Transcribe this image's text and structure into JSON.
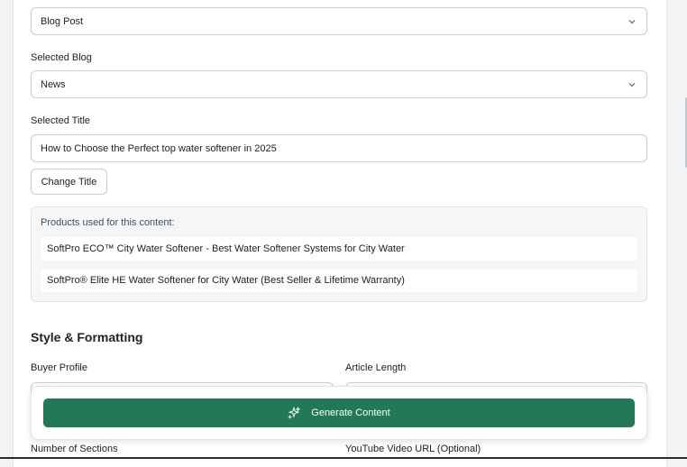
{
  "content_type": {
    "value": "Blog Post"
  },
  "selected_blog": {
    "label": "Selected Blog",
    "value": "News"
  },
  "selected_title": {
    "label": "Selected Title",
    "value": "How to Choose the Perfect top water softener in 2025",
    "change_button": "Change Title"
  },
  "products": {
    "heading": "Products used for this content:",
    "items": [
      "SoftPro ECO™ City Water Softener - Best Water Softener Systems for City Water",
      "SoftPro® Elite HE Water Softener for City Water (Best Seller & Lifetime Warranty)"
    ]
  },
  "style_section": {
    "title": "Style & Formatting",
    "buyer_profile_label": "Buyer Profile",
    "article_length_label": "Article Length",
    "number_of_sections_label": "Number of Sections",
    "youtube_label": "YouTube Video URL (Optional)"
  },
  "generate_button": {
    "label": "Generate Content",
    "icon": "sparkles-icon"
  },
  "colors": {
    "primary": "#217a55",
    "border": "#c9cccf"
  }
}
